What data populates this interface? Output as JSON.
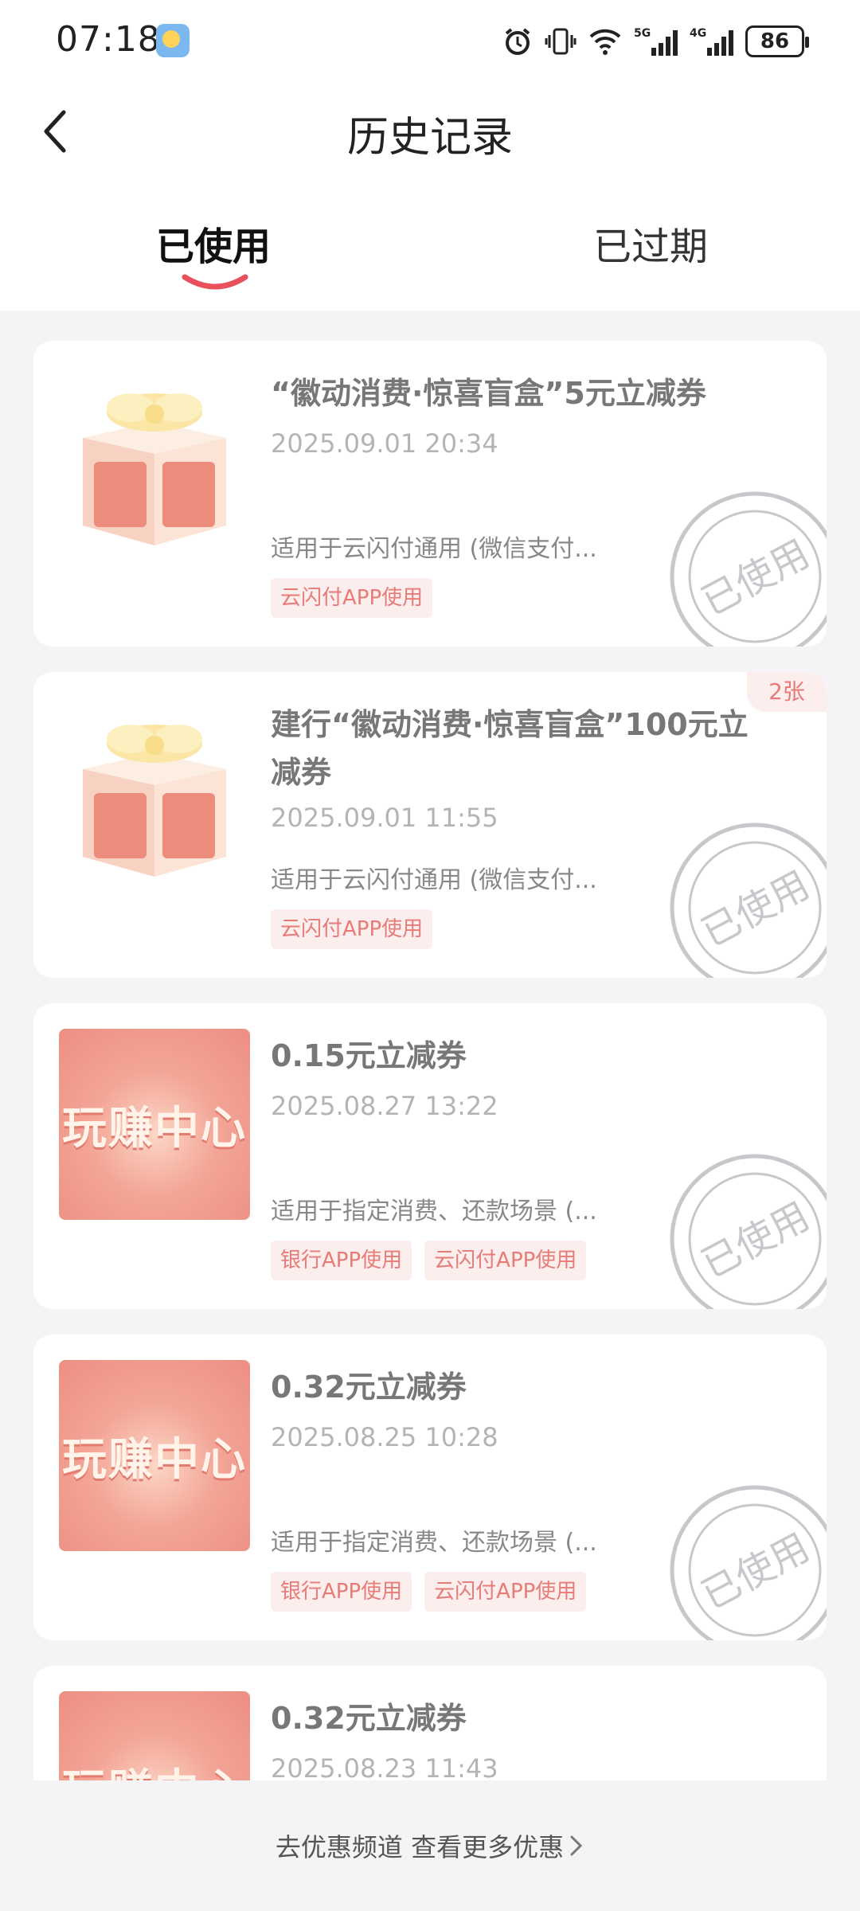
{
  "status_bar": {
    "time": "07:18",
    "battery": "86",
    "icons": [
      "weather-icon",
      "alarm-icon",
      "vibrate-icon",
      "wifi-icon",
      "signal-5g-icon",
      "signal-4g-icon",
      "battery-icon"
    ]
  },
  "header": {
    "title": "历史记录",
    "tabs": [
      {
        "label": "已使用",
        "active": true
      },
      {
        "label": "已过期",
        "active": false
      }
    ]
  },
  "coupons": [
    {
      "title": "“徽动消费·惊喜盲盒”5元立减券",
      "time": "2025.09.01 20:34",
      "desc": "适用于云闪付通用 (微信支付...",
      "tags": [
        "云闪付APP使用"
      ],
      "stamp": "已使用",
      "thumb": "gift-box"
    },
    {
      "title": "建行“徽动消费·惊喜盲盒”100元立减券",
      "count": "2张",
      "time": "2025.09.01 11:55",
      "desc": "适用于云闪付通用 (微信支付...",
      "tags": [
        "云闪付APP使用"
      ],
      "stamp": "已使用",
      "thumb": "gift-box"
    },
    {
      "title": "0.15元立减券",
      "time": "2025.08.27 13:22",
      "desc": "适用于指定消费、还款场景 (...",
      "tags": [
        "银行APP使用",
        "云闪付APP使用"
      ],
      "stamp": "已使用",
      "thumb_text": "玩赚中心"
    },
    {
      "title": "0.32元立减券",
      "time": "2025.08.25 10:28",
      "desc": "适用于指定消费、还款场景 (...",
      "tags": [
        "银行APP使用",
        "云闪付APP使用"
      ],
      "stamp": "已使用",
      "thumb_text": "玩赚中心"
    },
    {
      "title": "0.32元立减券",
      "time": "2025.08.23 11:43",
      "thumb_text": "玩赚中心"
    }
  ],
  "footer": {
    "more_link": "去优惠频道 查看更多优惠"
  },
  "colors": {
    "accent": "#e8505b",
    "tag_bg": "#fdeeee",
    "tag_text": "#e77b78",
    "stamp": "#c8c8cc"
  }
}
